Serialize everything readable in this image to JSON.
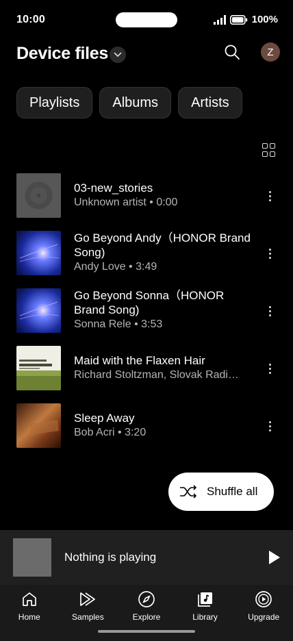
{
  "status": {
    "time": "10:00",
    "battery": "100%"
  },
  "header": {
    "title": "Device files",
    "avatar_letter": "Z"
  },
  "chips": [
    "Playlists",
    "Albums",
    "Artists"
  ],
  "tracks": [
    {
      "title": "03-new_stories",
      "subtitle": "Unknown artist • 0:00"
    },
    {
      "title": "Go Beyond Andy（HONOR Brand Song)",
      "subtitle": "Andy Love • 3:49"
    },
    {
      "title": "Go Beyond Sonna（HONOR Brand Song)",
      "subtitle": "Sonna Rele • 3:53"
    },
    {
      "title": "Maid with the Flaxen Hair",
      "subtitle": "Richard Stoltzman, Slovak Radi…"
    },
    {
      "title": "Sleep Away",
      "subtitle": "Bob Acri • 3:20"
    }
  ],
  "shuffle": {
    "label": "Shuffle all"
  },
  "mini_player": {
    "text": "Nothing is playing"
  },
  "nav": [
    {
      "label": "Home",
      "icon": "home-icon"
    },
    {
      "label": "Samples",
      "icon": "samples-icon"
    },
    {
      "label": "Explore",
      "icon": "compass-icon"
    },
    {
      "label": "Library",
      "icon": "library-icon"
    },
    {
      "label": "Upgrade",
      "icon": "upgrade-icon"
    }
  ],
  "colors": {
    "background": "#000000",
    "surface": "#1f1f1f",
    "mini_player": "#202020",
    "nav": "#1a1a1a",
    "avatar": "#6d4a3f"
  }
}
